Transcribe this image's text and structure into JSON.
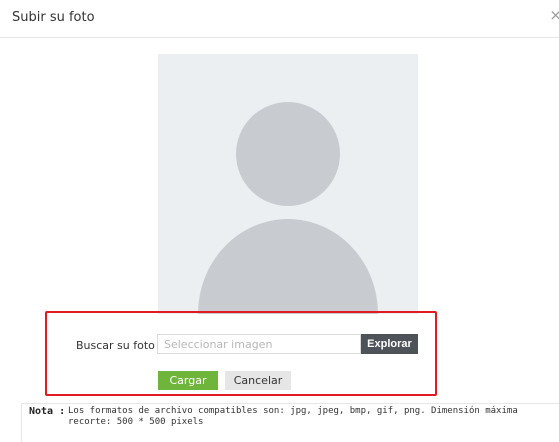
{
  "dialog": {
    "title": "Subir su foto",
    "close_symbol": "×"
  },
  "avatar": {
    "icon": "user-avatar-placeholder"
  },
  "upload_form": {
    "browse_label": "Buscar su foto",
    "file_placeholder": "Seleccionar imagen",
    "file_value": "",
    "explore_label": "Explorar",
    "upload_label": "Cargar",
    "cancel_label": "Cancelar"
  },
  "note": {
    "label": "Nota :",
    "text": "Los formatos de archivo compatibles son: jpg, jpeg, bmp, gif, png. Dimensión máxima recorte: 500 * 500 pixels"
  },
  "colors": {
    "highlight": "#e21b23",
    "upload_button": "#6fb53b",
    "explore_button": "#4d5358",
    "avatar_background": "#eceff2",
    "avatar_figure": "#c8ccd1"
  }
}
